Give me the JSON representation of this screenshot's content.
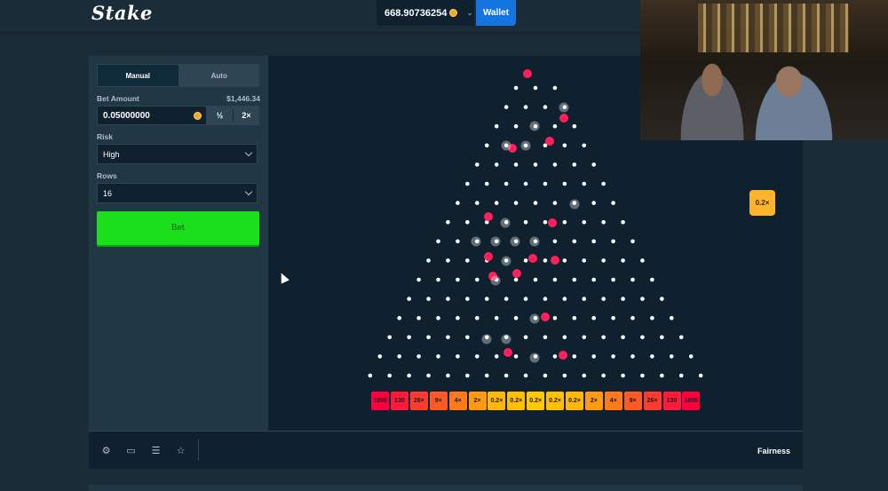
{
  "header": {
    "logo_text": "Stake",
    "balance": "668.90736254",
    "wallet_label": "Wallet"
  },
  "sidebar": {
    "tabs": [
      {
        "label": "Manual",
        "active": true
      },
      {
        "label": "Auto",
        "active": false
      }
    ],
    "bet_amount_label": "Bet Amount",
    "bet_amount_usd": "$1,446.34",
    "bet_amount_value": "0.05000000",
    "half_label": "½",
    "double_label": "2×",
    "risk_label": "Risk",
    "risk_value": "High",
    "rows_label": "Rows",
    "rows_value": "16",
    "bet_button_label": "Bet"
  },
  "board": {
    "rows": 16,
    "buckets": [
      {
        "label": "1000",
        "color": "#ff003f"
      },
      {
        "label": "130",
        "color": "#ff1a3a"
      },
      {
        "label": "26×",
        "color": "#ff3a30"
      },
      {
        "label": "9×",
        "color": "#ff5a26"
      },
      {
        "label": "4×",
        "color": "#ff7a1c"
      },
      {
        "label": "2×",
        "color": "#ff9a12"
      },
      {
        "label": "0.2×",
        "color": "#ffb708"
      },
      {
        "label": "0.2×",
        "color": "#ffc000"
      },
      {
        "label": "0.2×",
        "color": "#ffc800"
      },
      {
        "label": "0.2×",
        "color": "#ffc000"
      },
      {
        "label": "0.2×",
        "color": "#ffb708"
      },
      {
        "label": "2×",
        "color": "#ff9a12"
      },
      {
        "label": "4×",
        "color": "#ff7a1c"
      },
      {
        "label": "9×",
        "color": "#ff5a26"
      },
      {
        "label": "26×",
        "color": "#ff3a30"
      },
      {
        "label": "130",
        "color": "#ff1a3a"
      },
      {
        "label": "1000",
        "color": "#ff003f"
      }
    ],
    "last_multiplier": "0.2×",
    "ball_color": "#ff1f5a",
    "peg_color": "#ffffff"
  },
  "footer": {
    "icons": [
      "gear-icon",
      "theatre-mode-icon",
      "stats-icon",
      "star-icon"
    ],
    "fairness_label": "Fairness"
  }
}
